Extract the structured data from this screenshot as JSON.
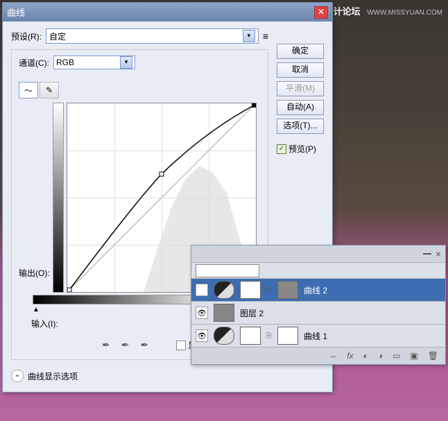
{
  "watermark": {
    "main": "思缘设计论坛",
    "sub": "WWW.MISSYUAN.COM"
  },
  "dialog": {
    "title": "曲线",
    "preset_label": "预设(R):",
    "preset_value": "自定",
    "channel_label": "通道(C):",
    "channel_value": "RGB",
    "output_label": "输出(O):",
    "input_label": "输入(I):",
    "show_clip": "显示修剪(W)",
    "expand": "曲线显示选项",
    "buttons": {
      "ok": "确定",
      "cancel": "取消",
      "smooth": "平滑(M)",
      "auto": "自动(A)",
      "options": "选项(T)..."
    },
    "preview": "预览(P)"
  },
  "layers": {
    "items": [
      {
        "name": "曲线 2"
      },
      {
        "name": "图层 2"
      },
      {
        "name": "曲线 1"
      }
    ]
  },
  "chart_data": {
    "type": "line",
    "title": "曲线 RGB",
    "xlabel": "输入",
    "ylabel": "输出",
    "xlim": [
      0,
      255
    ],
    "ylim": [
      0,
      255
    ],
    "series": [
      {
        "name": "baseline",
        "x": [
          0,
          255
        ],
        "y": [
          0,
          255
        ]
      },
      {
        "name": "curve",
        "x": [
          0,
          128,
          255
        ],
        "y": [
          0,
          160,
          255
        ]
      }
    ],
    "histogram_peak_input_range": [
      110,
      230
    ]
  }
}
